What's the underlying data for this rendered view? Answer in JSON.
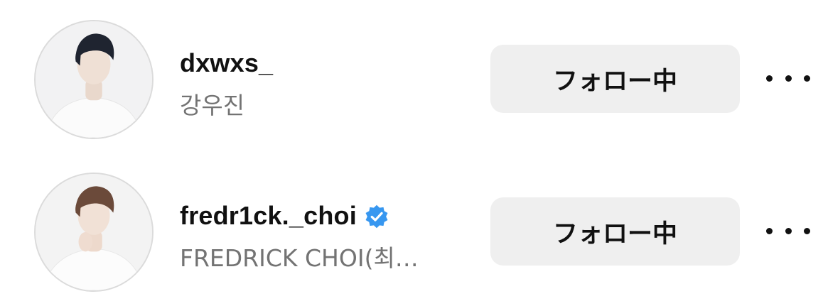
{
  "accounts": [
    {
      "username": "dxwxs_",
      "full_name": "강우진",
      "verified": false,
      "follow_label": "フォロー中",
      "avatar_icon": "user-avatar-photo"
    },
    {
      "username": "fredr1ck._choi",
      "full_name": "FREDRICK CHOI(최…",
      "verified": true,
      "follow_label": "フォロー中",
      "avatar_icon": "user-avatar-photo"
    }
  ],
  "colors": {
    "verified_badge": "#3797f0",
    "button_bg": "#efefef",
    "secondary_text": "#737373"
  }
}
